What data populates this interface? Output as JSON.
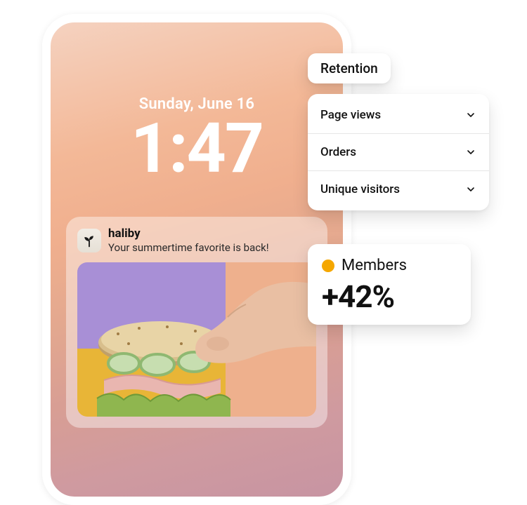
{
  "phone": {
    "date": "Sunday, June 16",
    "time": "1:47",
    "notification": {
      "app": "haliby",
      "body": "Your summertime favorite is back!",
      "icon_name": "sprout-icon"
    }
  },
  "pill": {
    "label": "Retention"
  },
  "metrics": [
    {
      "label": "Page views"
    },
    {
      "label": "Orders"
    },
    {
      "label": "Unique visitors"
    }
  ],
  "members": {
    "label": "Members",
    "delta": "+42%",
    "dot_color": "#f5a700"
  }
}
